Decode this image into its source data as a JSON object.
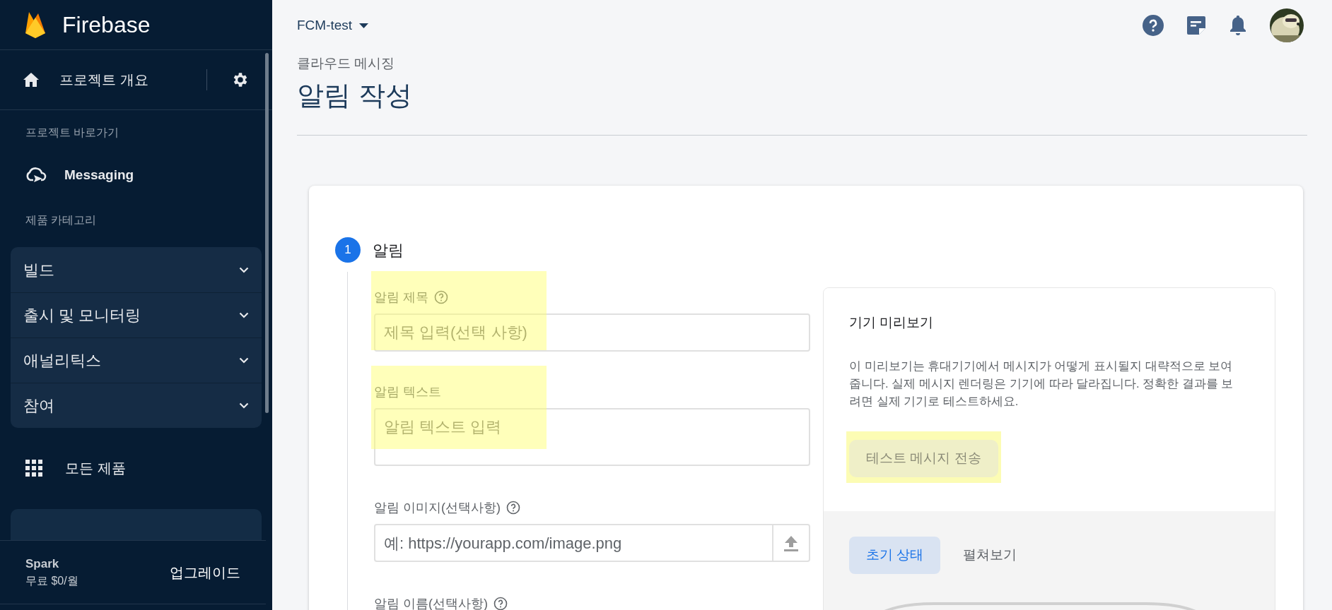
{
  "sidebar": {
    "brand": "Firebase",
    "overview": {
      "label": "프로젝트 개요"
    },
    "shortcuts_heading": "프로젝트 바로가기",
    "shortcuts": [
      {
        "label": "Messaging"
      }
    ],
    "categories_heading": "제품 카테고리",
    "categories": [
      {
        "label": "빌드",
        "expanded": false
      },
      {
        "label": "출시 및 모니터링",
        "expanded": false
      },
      {
        "label": "애널리틱스",
        "expanded": false
      },
      {
        "label": "참여",
        "expanded": false
      }
    ],
    "all_products": "모든 제품",
    "plan": {
      "name": "Spark",
      "price": "무료 $0/월",
      "upgrade": "업그레이드"
    }
  },
  "header": {
    "project": "FCM-test",
    "breadcrumb": "클라우드 메시징",
    "title": "알림 작성"
  },
  "step": {
    "number": "1",
    "title": "알림"
  },
  "fields": [
    {
      "kind": "input",
      "label": "알림 제목",
      "help": true,
      "placeholder": "제목 입력(선택 사항)",
      "highlighted": true
    },
    {
      "kind": "textarea",
      "label": "알림 텍스트",
      "help": false,
      "placeholder": "알림 텍스트 입력",
      "highlighted": true
    },
    {
      "kind": "upload",
      "label": "알림 이미지(선택사항)",
      "help": true,
      "placeholder": "예: https://yourapp.com/image.png",
      "highlighted": false
    },
    {
      "kind": "label",
      "label": "알림 이름(선택사항)",
      "help": true,
      "highlighted": false
    }
  ],
  "preview": {
    "title": "기기 미리보기",
    "description": "이 미리보기는 휴대기기에서 메시지가 어떻게 표시될지 대략적으로 보여줍니다. 실제 메시지 렌더링은 기기에 따라 달라집니다. 정확한 결과를 보려면 실제 기기로 테스트하세요.",
    "test_button": {
      "label": "테스트 메시지 전송",
      "disabled": true,
      "highlighted": true
    },
    "tabs": [
      {
        "label": "초기 상태",
        "selected": true
      },
      {
        "label": "펼쳐보기",
        "selected": false
      }
    ]
  }
}
